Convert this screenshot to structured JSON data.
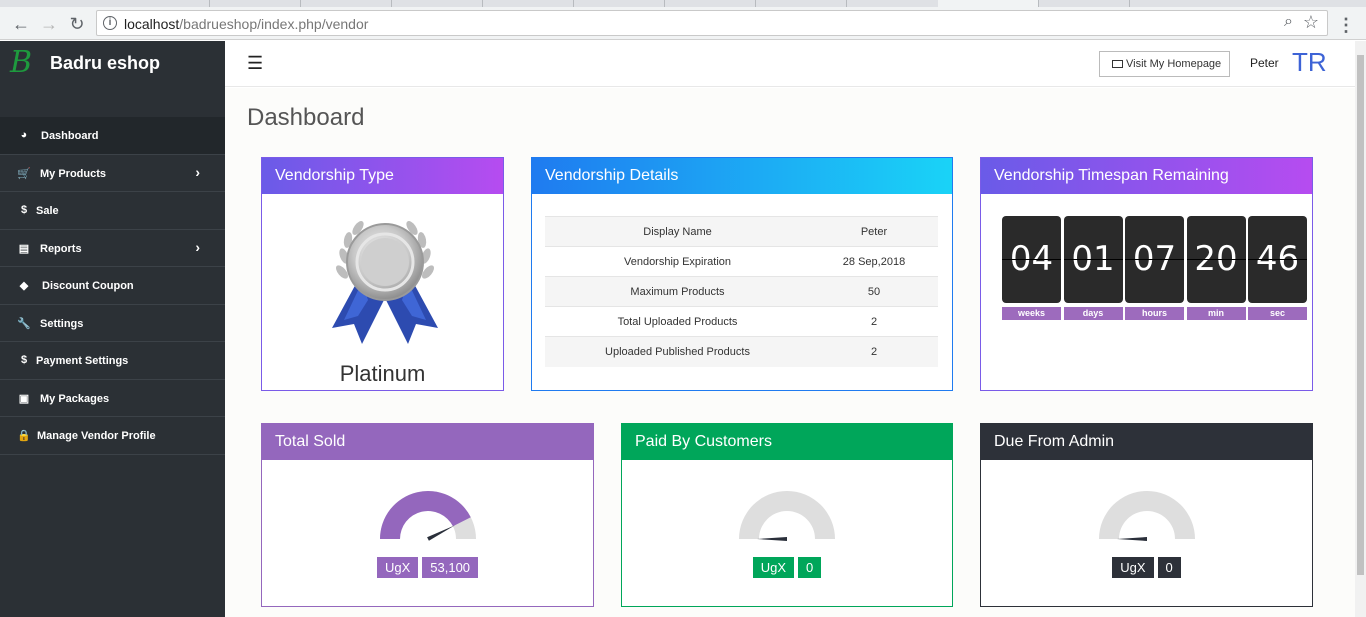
{
  "browser": {
    "url_host": "localhost",
    "url_path": "/badrueshop/index.php/vendor"
  },
  "sidebar": {
    "brand_logo": "B",
    "brand_name": "Badru eshop",
    "items": [
      {
        "label": "Dashboard",
        "icon": "dashboard-icon",
        "glyph": "◕",
        "active": true,
        "has_arrow": false
      },
      {
        "label": "My Products",
        "icon": "cart-icon",
        "glyph": "🛒",
        "active": false,
        "has_arrow": true
      },
      {
        "label": "Sale",
        "icon": "dollar-icon",
        "glyph": "$",
        "active": false,
        "has_arrow": false
      },
      {
        "label": "Reports",
        "icon": "file-icon",
        "glyph": "▤",
        "active": false,
        "has_arrow": true
      },
      {
        "label": "Discount Coupon",
        "icon": "tags-icon",
        "glyph": "◆",
        "active": false,
        "has_arrow": false
      },
      {
        "label": "Settings",
        "icon": "wrench-icon",
        "glyph": "🔧",
        "active": false,
        "has_arrow": false
      },
      {
        "label": "Payment Settings",
        "icon": "dollar-icon",
        "glyph": "$",
        "active": false,
        "has_arrow": false
      },
      {
        "label": "My Packages",
        "icon": "gift-icon",
        "glyph": "▣",
        "active": false,
        "has_arrow": false
      },
      {
        "label": "Manage Vendor Profile",
        "icon": "lock-icon",
        "glyph": "🔒",
        "active": false,
        "has_arrow": false
      }
    ]
  },
  "header": {
    "visit_label": "Visit My Homepage",
    "user_name": "Peter",
    "user_initials": "TR"
  },
  "page_title": "Dashboard",
  "vendorship_type": {
    "title": "Vendorship Type",
    "plan": "Platinum",
    "head_colors": [
      "#6a5be8",
      "#b64cf0"
    ]
  },
  "vendorship_details": {
    "title": "Vendorship Details",
    "head_colors": [
      "#1f7bf0",
      "#1ad3f7"
    ],
    "rows": [
      {
        "key": "Display Name",
        "value": "Peter"
      },
      {
        "key": "Vendorship Expiration",
        "value": "28 Sep,2018"
      },
      {
        "key": "Maximum Products",
        "value": "50"
      },
      {
        "key": "Total Uploaded Products",
        "value": "2"
      },
      {
        "key": "Uploaded Published Products",
        "value": "2"
      }
    ]
  },
  "timespan": {
    "title": "Vendorship Timespan Remaining",
    "units": [
      {
        "value": "04",
        "label": "weeks"
      },
      {
        "value": "01",
        "label": "days"
      },
      {
        "value": "07",
        "label": "hours"
      },
      {
        "value": "20",
        "label": "min"
      },
      {
        "value": "46",
        "label": "sec"
      }
    ]
  },
  "stats": {
    "total_sold": {
      "title": "Total Sold",
      "currency": "UgX",
      "value": "53,100",
      "color": "#9467bd",
      "gauge_fraction": 0.85
    },
    "paid_by_customers": {
      "title": "Paid By Customers",
      "currency": "UgX",
      "value": "0",
      "color": "#00a65a",
      "gauge_fraction": 0
    },
    "due_from_admin": {
      "title": "Due From Admin",
      "currency": "UgX",
      "value": "0",
      "color": "#2d3139",
      "gauge_fraction": 0
    }
  }
}
